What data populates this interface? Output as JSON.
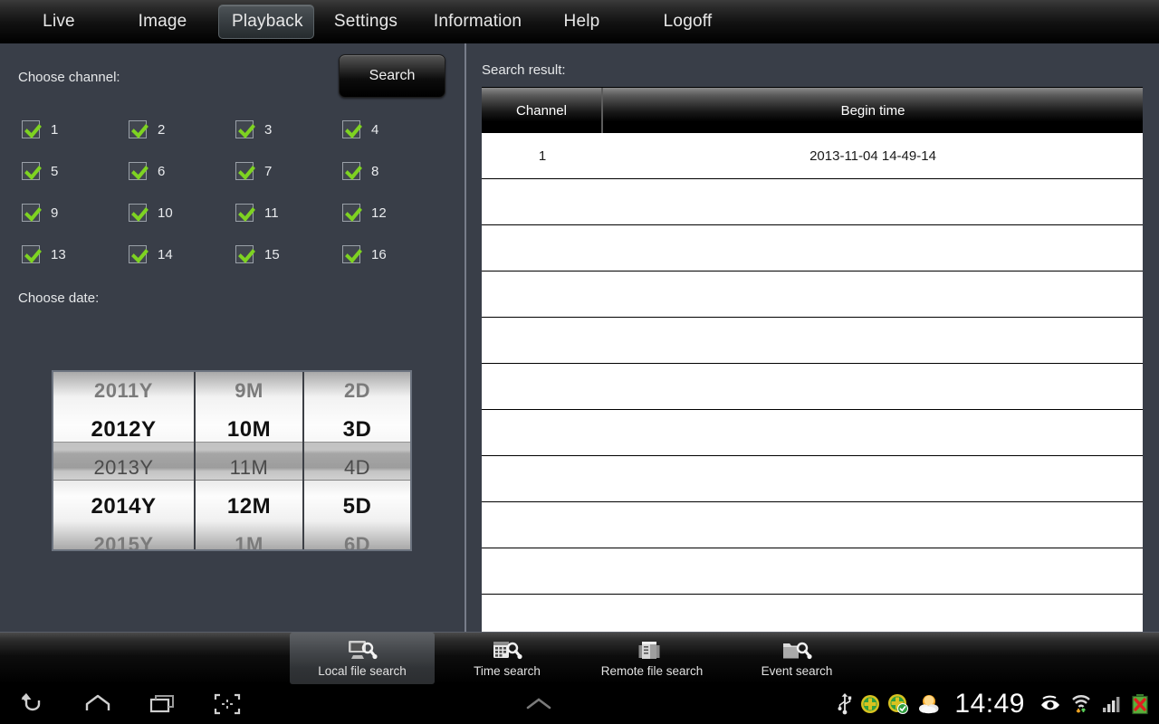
{
  "topnav": {
    "items": [
      {
        "label": "Live",
        "selected": false,
        "name": "tab-live"
      },
      {
        "label": "Image",
        "selected": false,
        "name": "tab-image"
      },
      {
        "label": "Playback",
        "selected": true,
        "name": "tab-playback"
      },
      {
        "label": "Settings",
        "selected": false,
        "name": "tab-settings"
      },
      {
        "label": "Information",
        "selected": false,
        "name": "tab-information"
      },
      {
        "label": "Help",
        "selected": false,
        "name": "tab-help"
      },
      {
        "label": "Logoff",
        "selected": false,
        "name": "tab-logoff"
      }
    ]
  },
  "left": {
    "choose_channel_label": "Choose channel:",
    "search_button_label": "Search",
    "choose_date_label": "Choose date:",
    "channels": [
      {
        "label": "1",
        "checked": true
      },
      {
        "label": "2",
        "checked": true
      },
      {
        "label": "3",
        "checked": true
      },
      {
        "label": "4",
        "checked": true
      },
      {
        "label": "5",
        "checked": true
      },
      {
        "label": "6",
        "checked": true
      },
      {
        "label": "7",
        "checked": true
      },
      {
        "label": "8",
        "checked": true
      },
      {
        "label": "9",
        "checked": true
      },
      {
        "label": "10",
        "checked": true
      },
      {
        "label": "11",
        "checked": true
      },
      {
        "label": "12",
        "checked": true
      },
      {
        "label": "13",
        "checked": true
      },
      {
        "label": "14",
        "checked": true
      },
      {
        "label": "15",
        "checked": true
      },
      {
        "label": "16",
        "checked": true
      }
    ],
    "date_spinner": {
      "year": {
        "items": [
          "2011Y",
          "2012Y",
          "2013Y",
          "2014Y",
          "2015Y"
        ],
        "selected": "2013Y",
        "selected_index": 2
      },
      "month": {
        "items": [
          "9M",
          "10M",
          "11M",
          "12M",
          "1M"
        ],
        "selected": "11M",
        "selected_index": 2
      },
      "day": {
        "items": [
          "2D",
          "3D",
          "4D",
          "5D",
          "6D"
        ],
        "selected": "4D",
        "selected_index": 2
      }
    }
  },
  "right": {
    "search_result_label": "Search result:",
    "columns": [
      "Channel",
      "Begin time"
    ],
    "rows": [
      {
        "channel": "1",
        "begin_time": "2013-11-04 14-49-14"
      },
      {
        "channel": "",
        "begin_time": ""
      },
      {
        "channel": "",
        "begin_time": ""
      },
      {
        "channel": "",
        "begin_time": ""
      },
      {
        "channel": "",
        "begin_time": ""
      },
      {
        "channel": "",
        "begin_time": ""
      },
      {
        "channel": "",
        "begin_time": ""
      },
      {
        "channel": "",
        "begin_time": ""
      },
      {
        "channel": "",
        "begin_time": ""
      },
      {
        "channel": "",
        "begin_time": ""
      },
      {
        "channel": "",
        "begin_time": ""
      }
    ]
  },
  "bottom_bar": {
    "items": [
      {
        "label": "Local file search",
        "icon": "monitor-search-icon",
        "selected": true
      },
      {
        "label": "Time search",
        "icon": "calendar-search-icon",
        "selected": false
      },
      {
        "label": "Remote file search",
        "icon": "server-icon",
        "selected": false
      },
      {
        "label": "Event search",
        "icon": "folder-search-icon",
        "selected": false
      }
    ]
  },
  "system_bar": {
    "nav": [
      "back-icon",
      "home-icon",
      "recents-icon",
      "screenshot-icon"
    ],
    "center": "chevron-up-icon",
    "clock": "14:49",
    "status_icons": [
      "usb-icon",
      "sync-icon",
      "sync-done-icon",
      "weather-icon",
      "eye-icon",
      "wifi-icon",
      "signal-icon",
      "battery-error-icon"
    ]
  },
  "colors": {
    "background": "#393E48",
    "accent_green": "#7ED321",
    "nav_black": "#000000",
    "table_white": "#FFFFFF"
  }
}
